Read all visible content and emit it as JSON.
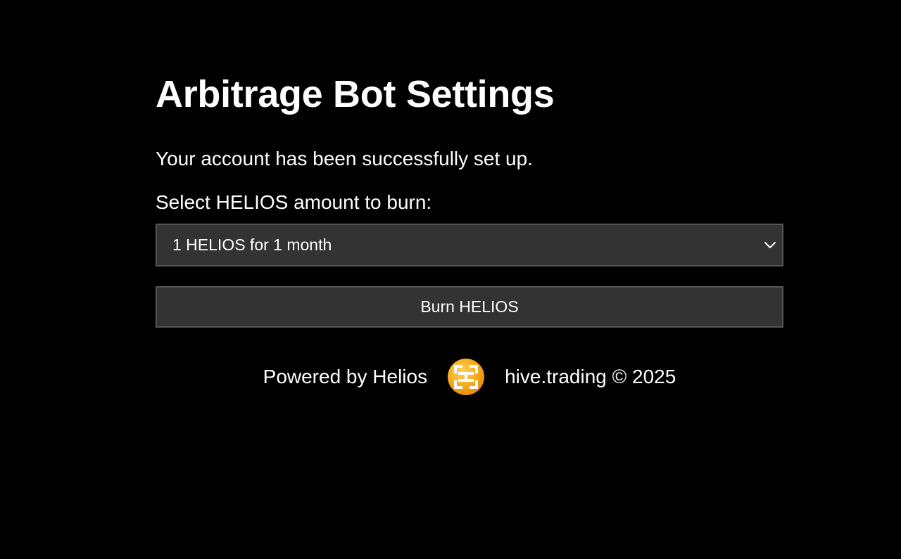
{
  "page": {
    "title": "Arbitrage Bot Settings",
    "status_message": "Your account has been successfully set up."
  },
  "form": {
    "select_label": "Select HELIOS amount to burn:",
    "selected_option": "1 HELIOS for 1 month",
    "burn_button_label": "Burn HELIOS"
  },
  "footer": {
    "powered_by": "Powered by Helios",
    "logo_icon": "helios-logo-icon",
    "copyright": "hive.trading © 2025"
  },
  "colors": {
    "background": "#000000",
    "text": "#ffffff",
    "control_bg": "#333333",
    "control_border": "#555555",
    "logo_orange": "#f5a623"
  }
}
